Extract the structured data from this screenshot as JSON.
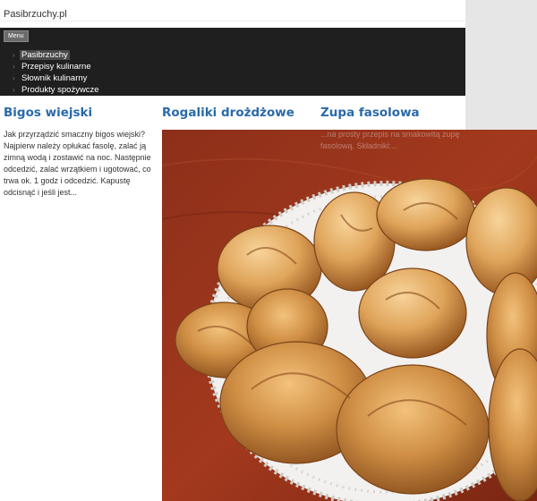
{
  "site": {
    "title": "Pasibrzuchy.pl"
  },
  "nav": {
    "menu_label": "Menu",
    "items": [
      {
        "label": "Pasibrzuchy",
        "active": true
      },
      {
        "label": "Przepisy kulinarne",
        "active": false
      },
      {
        "label": "Słownik kulinarny",
        "active": false
      },
      {
        "label": "Produkty spożywcze",
        "active": false
      }
    ]
  },
  "articles": [
    {
      "title": "Bigos wiejski",
      "excerpt": "Jak przyrządzić smaczny bigos wiejski? Najpierw należy opłukać fasolę, zalać ją zimną wodą i zostawić na noc. Następnie odcedzić, zalać wrzątkiem i ugotować, co trwa ok. 1 godz i odcedzić. Kapustę odcisnąć i jeśli jest..."
    },
    {
      "title": "Rogaliki drożdżowe",
      "image_alt": "Rogaliki drożdżowe"
    },
    {
      "title": "Zupa fasolowa",
      "excerpt": "...na prosty przepis na smakowitą zupę fasolową. Składniki:..."
    }
  ],
  "colors": {
    "nav_bg": "#1f1f1f",
    "title_link": "#2a6aa8",
    "page_bg": "#e6e6e6"
  }
}
